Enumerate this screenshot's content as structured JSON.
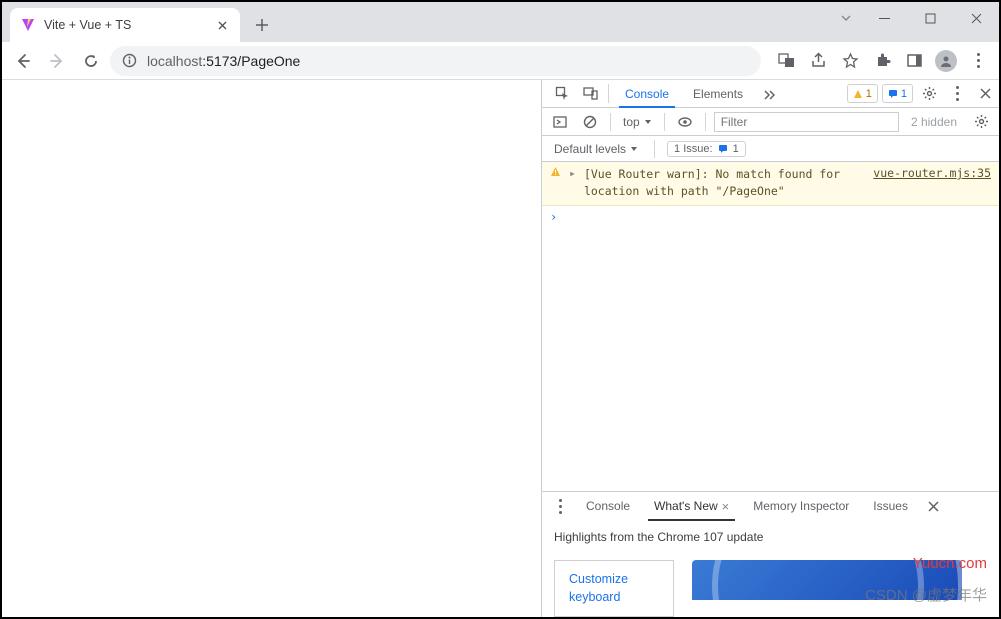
{
  "window": {
    "tab_title": "Vite + Vue + TS"
  },
  "url": {
    "host": "localhost",
    "port_path": ":5173/PageOne"
  },
  "devtools": {
    "tabs": {
      "console": "Console",
      "elements": "Elements"
    },
    "warn_badge": "1",
    "info_badge": "1",
    "context": "top",
    "filter_placeholder": "Filter",
    "hidden": "2 hidden",
    "levels": "Default levels",
    "issues_label": "1 Issue:",
    "issues_count": "1",
    "warn_msg": "[Vue Router warn]: No match found for location with path \"/PageOne\"",
    "warn_src": "vue-router.mjs:35"
  },
  "drawer": {
    "tabs": {
      "console": "Console",
      "whatsnew": "What's New",
      "memory": "Memory Inspector",
      "issues": "Issues"
    },
    "headline": "Highlights from the Chrome 107 update",
    "card_link_l1": "Customize",
    "card_link_l2": "keyboard"
  },
  "watermarks": {
    "site": "Yuucn.com",
    "author": "CSDN @虚梦年华"
  }
}
